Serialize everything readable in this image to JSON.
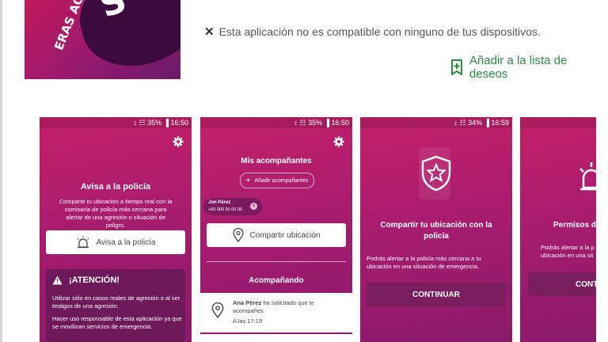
{
  "app": {
    "logo_text": "ERAS AGRE",
    "logo_tail": "S"
  },
  "compat": {
    "icon": "close-icon",
    "text": "Esta aplicación no es compatible con ninguno de tus dispositivos."
  },
  "wishlist": {
    "icon": "bookmark-add-icon",
    "label": "Añadir a la lista de deseos",
    "color": "#2b8a3e"
  },
  "screenshots": [
    {
      "status": "↕ ☷ 35% ▐ 16:50",
      "title": "Avisa a la policía",
      "text": "Comparte tu ubicación a tiempo real con la comisaría de policía más cercana para alertar de una agresión o situación de peligro.",
      "button": "Avisa a la policía",
      "attention_title": "¡ATENCIÓN!",
      "attention_text_1": "Utilizar sólo en casos reales de agresión o al ser testigos de una agresión.",
      "attention_text_2": "Hacer uso responsable de esta aplicación ya que se movilizan servicios de emergencia."
    },
    {
      "status": "↕ ☷ 35% ▐ 16:50",
      "title": "Mis acompañantes",
      "add_label": "Añadir acompañantes",
      "contact_name": "Jon Pérez",
      "contact_phone": "+00 000 00 00 00",
      "share_button": "Compartir ubicación",
      "section": "Acompañando",
      "request_name": "Ana Pérez",
      "request_text": "ha solicitado que le acompañes",
      "request_time": "A las 17:19"
    },
    {
      "status": "↕ ☷ 34% ▐ 16:59",
      "title": "Compartir tu ubicación con la policía",
      "text": "Podrás alertar a la policía más cercana a tu ubicación en una situación de emergencia.",
      "button": "CONTINUAR"
    },
    {
      "title": "Permisos de",
      "text": "Podrás alertar a la p ubicación en una sit",
      "button": "CONTI"
    }
  ],
  "colors": {
    "brand": "#a31b6f",
    "attention": "#6e1a5a",
    "button_dark": "#7a1d5c"
  }
}
